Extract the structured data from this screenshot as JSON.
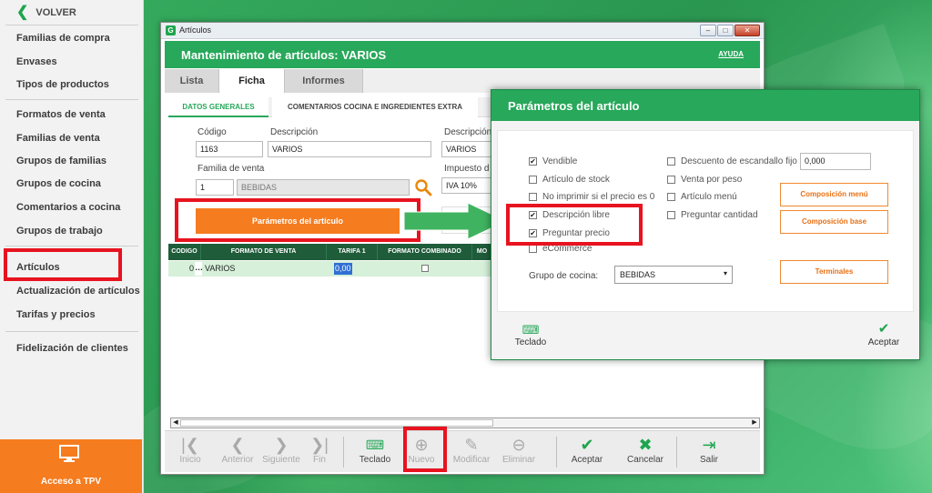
{
  "sidebar": {
    "back_label": "VOLVER",
    "items": [
      "Familias de compra",
      "Envases",
      "Tipos de productos",
      "Formatos de venta",
      "Familias de venta",
      "Grupos de familias",
      "Grupos de cocina",
      "Comentarios a cocina",
      "Grupos de trabajo",
      "Artículos",
      "Actualización de artículos",
      "Tarifas y precios",
      "Fidelización de clientes"
    ],
    "tpv_label": "Acceso a TPV"
  },
  "window": {
    "icon_letter": "G",
    "title": "Artículos",
    "header_title": "Mantenimiento de artículos: VARIOS",
    "help_label": "AYUDA",
    "tabs": [
      "Lista",
      "Ficha",
      "Informes"
    ],
    "subtabs": [
      "DATOS GENERALES",
      "COMENTARIOS COCINA E INGREDIENTES EXTRA"
    ],
    "form": {
      "codigo_label": "Código",
      "codigo_value": "1163",
      "descripcion_label": "Descripción",
      "descripcion_value": "VARIOS",
      "descripcion2_label": "Descripción",
      "descripcion2_value": "VARIOS",
      "familia_label": "Familia de venta",
      "familia_code": "1",
      "familia_value": "BEBIDAS",
      "impuesto_label": "Impuesto d",
      "impuesto_value": "IVA 10%",
      "params_button": "Parámetros del artículo"
    },
    "grid": {
      "headers": [
        "CODIGO",
        "FORMATO DE VENTA",
        "TARIFA 1",
        "FORMATO COMBINADO",
        "MO"
      ],
      "row": {
        "codigo": "0",
        "formato": "VARIOS",
        "tarifa": "0,00"
      }
    },
    "toolbar": [
      "Inicio",
      "Anterior",
      "Siguiente",
      "Fin",
      "Teclado",
      "Nuevo",
      "Modificar",
      "Eliminar",
      "Aceptar",
      "Cancelar",
      "Salir"
    ]
  },
  "dialog": {
    "title": "Parámetros del artículo",
    "left_checks": [
      {
        "label": "Vendible",
        "checked": true
      },
      {
        "label": "Artículo de stock",
        "checked": false
      },
      {
        "label": "No imprimir si el precio es 0",
        "checked": false
      },
      {
        "label": "Descripción libre",
        "checked": true
      },
      {
        "label": "Preguntar precio",
        "checked": true
      },
      {
        "label": "eCommerce",
        "checked": false
      }
    ],
    "right_checks": [
      {
        "label": "Descuento de escandallo fijo",
        "checked": false
      },
      {
        "label": "Venta por peso",
        "checked": false
      },
      {
        "label": "Artículo menú",
        "checked": false
      },
      {
        "label": "Preguntar cantidad",
        "checked": false
      }
    ],
    "descuento_value": "0,000",
    "buttons": [
      "Composición menú",
      "Composición base",
      "Terminales"
    ],
    "grupo_cocina_label": "Grupo de cocina:",
    "grupo_cocina_value": "BEBIDAS",
    "teclado_label": "Teclado",
    "aceptar_label": "Aceptar"
  },
  "colors": {
    "brand_green": "#27a85a",
    "accent_orange": "#f57c1f",
    "highlight_red": "#e8131f"
  }
}
